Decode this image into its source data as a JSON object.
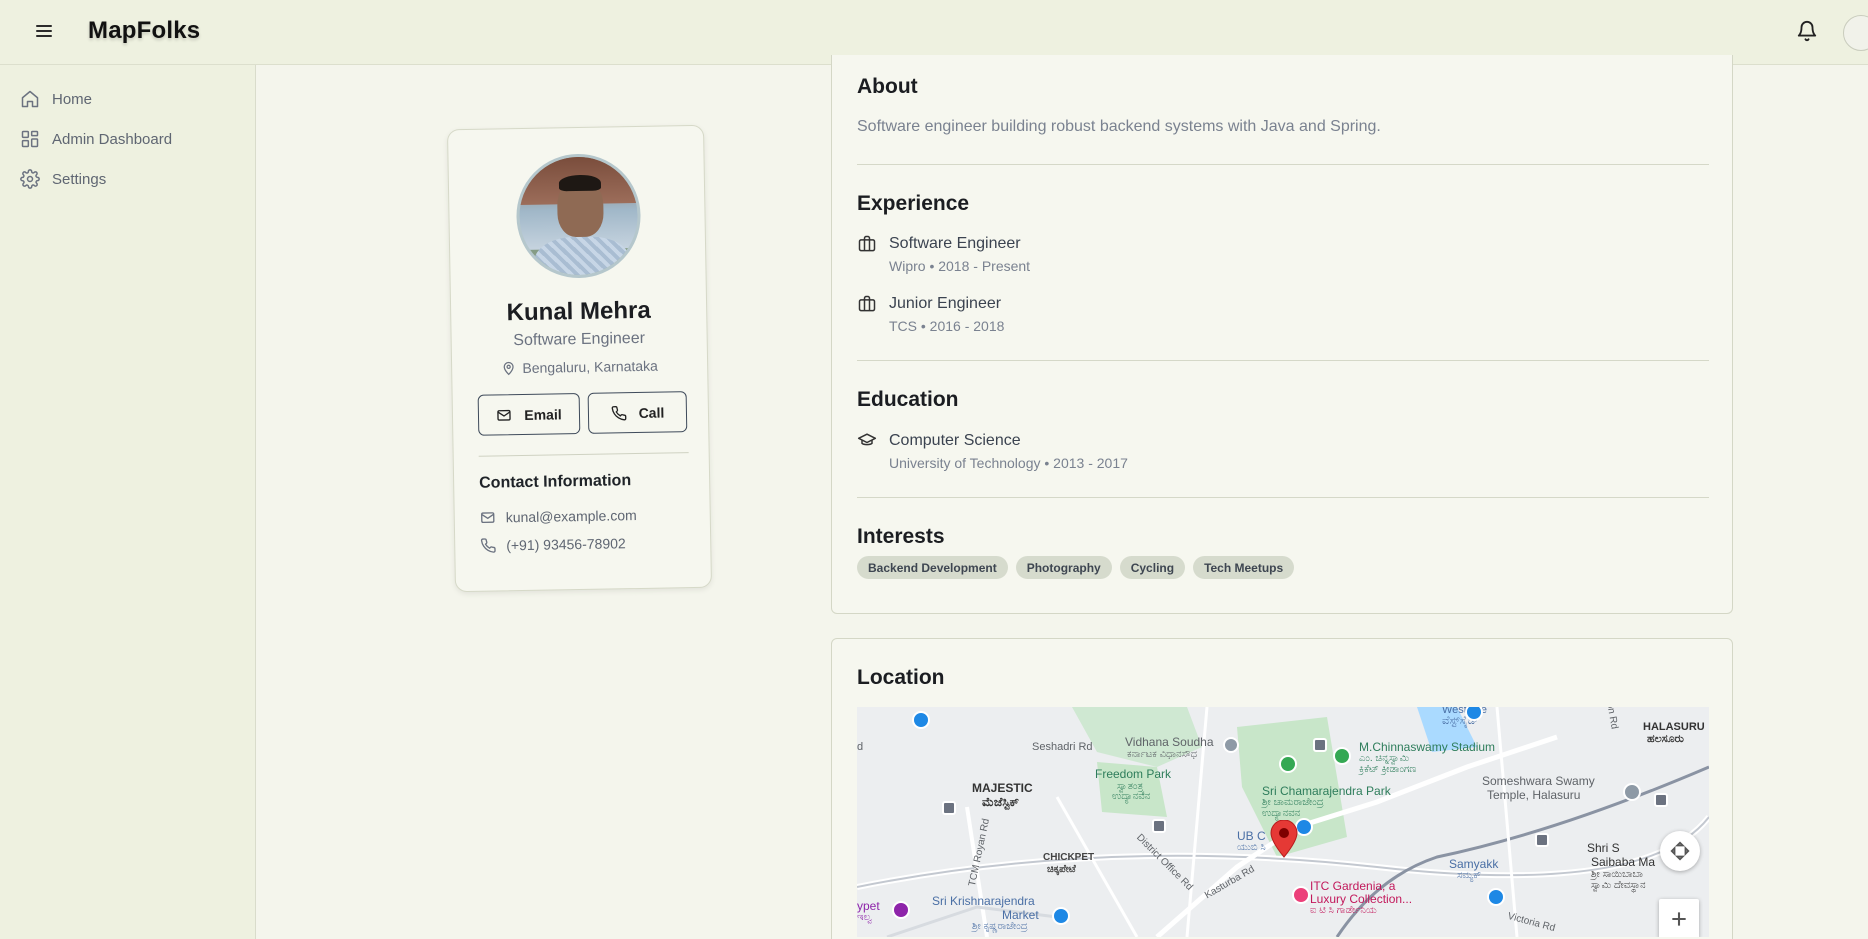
{
  "app": {
    "brand": "MapFolks"
  },
  "topbar": {
    "menu_icon": "hamburger-icon",
    "notifications_icon": "bell-icon"
  },
  "sidebar": {
    "items": [
      {
        "label": "Home",
        "icon": "home-icon"
      },
      {
        "label": "Admin Dashboard",
        "icon": "dashboard-icon"
      },
      {
        "label": "Settings",
        "icon": "gear-icon"
      }
    ]
  },
  "profile": {
    "name": "Kunal Mehra",
    "role": "Software Engineer",
    "location": "Bengaluru, Karnataka",
    "email_button": "Email",
    "call_button": "Call",
    "contact_title": "Contact Information",
    "email": "kunal@example.com",
    "phone": "(+91) 93456-78902"
  },
  "about": {
    "heading": "About",
    "text": "Software engineer building robust backend systems with Java and Spring."
  },
  "experience": {
    "heading": "Experience",
    "items": [
      {
        "title": "Software Engineer",
        "subtitle": "Wipro • 2018 - Present"
      },
      {
        "title": "Junior Engineer",
        "subtitle": "TCS • 2016 - 2018"
      }
    ]
  },
  "education": {
    "heading": "Education",
    "items": [
      {
        "title": "Computer Science",
        "subtitle": "University of Technology • 2013 - 2017"
      }
    ]
  },
  "interests": {
    "heading": "Interests",
    "tags": [
      "Backend Development",
      "Photography",
      "Cycling",
      "Tech Meetups"
    ]
  },
  "location": {
    "heading": "Location",
    "map_labels": {
      "westside": "Westside",
      "westside_kn": "ವೆಸ್ಟ್‌ಸೈಡ್",
      "halasuru": "HALASURU",
      "halasuru_kn": "ಹಲಸೂರು",
      "seshadri": "Seshadri Rd",
      "vidhana": "Vidhana Soudha",
      "vidhana_kn": "ಕರ್ನಾಟಕ ವಿಧಾನಸೌಧ",
      "stadium": "M.Chinnaswamy Stadium",
      "stadium_kn": "ಎಂ. ಚಿನ್ನಸ್ವಾಮಿ",
      "stadium_kn2": "ಕ್ರಿಕೆಟ್ ಕ್ರೀಡಾಂಗಣ",
      "majestic": "MAJESTIC",
      "majestic_kn": "ಮೆಜೆಸ್ಟಿಕ್",
      "freedom": "Freedom Park",
      "freedom_kn": "ಸ್ವಾತಂತ್ರ್ಯ",
      "freedom_kn2": "ಉದ್ಯಾನವನ",
      "chamarajendra": "Sri Chamarajendra Park",
      "chamarajendra_kn": "ಶ್ರೀ ಚಾಮರಾಜೇಂದ್ರ",
      "chamarajendra_kn2": "ಉದ್ಯಾನವನ",
      "someshwara": "Someshwara Swamy",
      "someshwara2": "Temple, Halasuru",
      "ub": "UB C",
      "ub_kn": "ಯುಬಿ ಸಿ",
      "chickpet": "CHICKPET",
      "chickpet_kn": "ಚಿಕ್ಕಪೇಟೆ",
      "district": "District Office Rd",
      "tcm": "TCM Royan Rd",
      "shri": "Shri S",
      "saibaba": "Saibaba Ma",
      "saibaba_kn": "ಶ್ರೀ ಸಾಯಿಬಾಬಾ",
      "saibaba_kn2": "ಸ್ವಾಮಿ ದೇವಸ್ಥಾನ",
      "samyakk": "Samyakk",
      "samyakk_kn": "ಸಮ್ಯಕ್",
      "kasturba": "Kasturba Rd",
      "krishnarajendra": "Sri Krishnarajendra",
      "market": "Market",
      "market_kn": "ಶ್ರೀ ಕೃಷ್ಣರಾಜೇಂದ್ರ",
      "itc": "ITC Gardenia, a",
      "itc2": "Luxury Collection...",
      "itc_kn": "ಐ ಟಿ ಸಿ ಗಾರ್ಡೇನಿಯ",
      "ypet": "ypet",
      "ypet_kn": "ಇಲ್ವ",
      "d": "d",
      "tonrd": "ton Rd",
      "victoria": "Victoria Rd"
    }
  },
  "colors": {
    "background": "#f4f5ec",
    "sidebar": "#eef1e0",
    "chip": "#d6dbcd",
    "map_pin": "#e53935",
    "map_park": "#c8e6c9",
    "map_water": "#aadaff"
  }
}
